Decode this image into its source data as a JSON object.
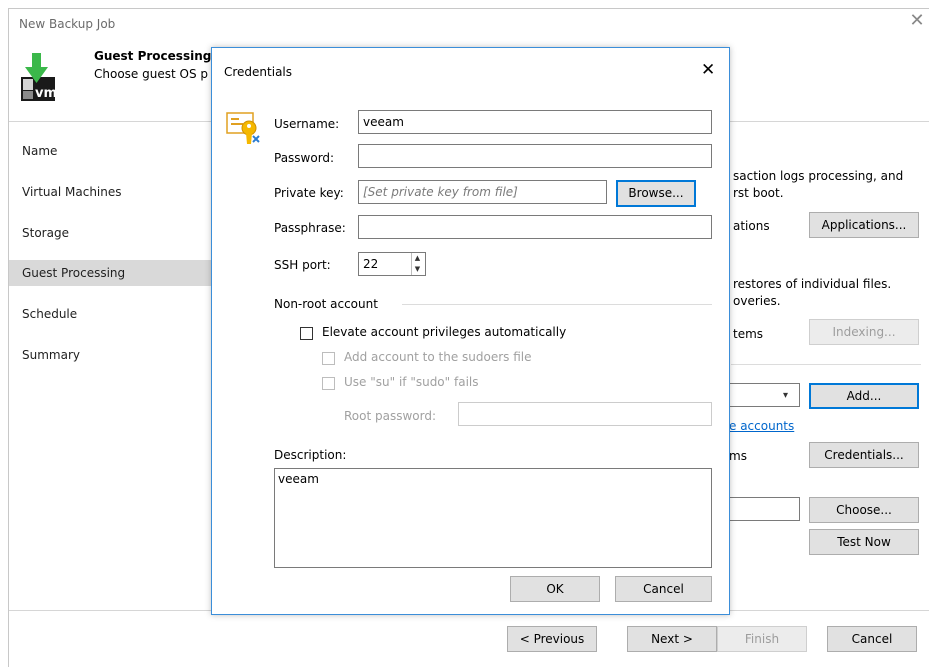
{
  "window": {
    "title": "New Backup Job"
  },
  "header": {
    "title": "Guest Processing",
    "subtitle": "Choose guest OS p"
  },
  "nav": [
    {
      "label": "Name"
    },
    {
      "label": "Virtual Machines"
    },
    {
      "label": "Storage"
    },
    {
      "label": "Guest Processing",
      "selected": true
    },
    {
      "label": "Schedule"
    },
    {
      "label": "Summary"
    }
  ],
  "right": {
    "line1": "saction logs processing, and",
    "line2": "rst boot.",
    "applications_label": "ations",
    "applications_button": "Applications...",
    "line3": "restores of individual files.",
    "line4": "overies.",
    "indexing_label": "tems",
    "indexing_button": "Indexing...",
    "add_button": "Add...",
    "accounts_link": "e accounts",
    "credentials_label": "ms",
    "credentials_button": "Credentials...",
    "choose_button": "Choose...",
    "test_button": "Test Now"
  },
  "footer": {
    "previous": "< Previous",
    "next": "Next >",
    "finish": "Finish",
    "cancel": "Cancel"
  },
  "dialog": {
    "title": "Credentials",
    "username_label": "Username:",
    "username_value": "veeam",
    "password_label": "Password:",
    "password_value": "",
    "private_key_label": "Private key:",
    "private_key_placeholder": "[Set private key from file]",
    "browse_button": "Browse...",
    "passphrase_label": "Passphrase:",
    "passphrase_value": "",
    "ssh_port_label": "SSH port:",
    "ssh_port_value": "22",
    "nonroot_group": "Non-root account",
    "elevate_label": "Elevate account privileges automatically",
    "sudoers_label": "Add account to the sudoers file",
    "su_label": "Use \"su\" if \"sudo\" fails",
    "root_password_label": "Root password:",
    "description_label": "Description:",
    "description_value": "veeam",
    "ok_button": "OK",
    "cancel_button": "Cancel"
  }
}
